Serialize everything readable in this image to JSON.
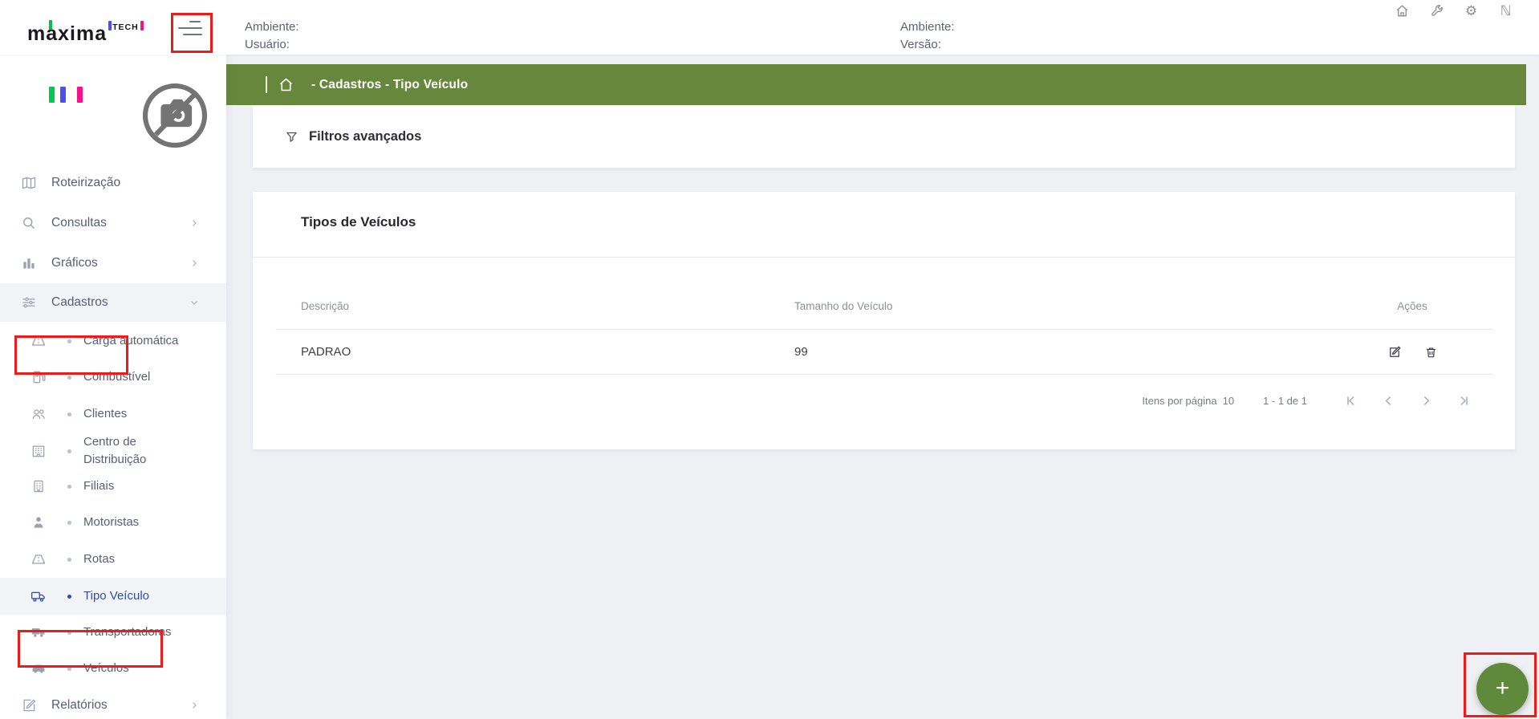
{
  "colors": {
    "breadcrumb_green": "#67873D",
    "fab_green": "#5F8A3C",
    "annotation_red": "#EE1B1B",
    "active_blue": "#2C4CAE",
    "edit_blue": "#3F58C9",
    "delete_red": "#E2403A",
    "logo_tick_green": "#00BF4F",
    "logo_tick_blue": "#4B50F0",
    "logo_tick_pink": "#F5128C"
  },
  "header": {
    "logo_text": "maxima",
    "logo_sub": "TECH",
    "env_label_left": "Ambiente:",
    "user_label": "Usuário:",
    "env_label_right": "Ambiente:",
    "version_label": "Versão:",
    "gear_glyph": "⚙",
    "n_glyph": "ℕ"
  },
  "breadcrumb": {
    "path": "- Cadastros - Tipo Veículo"
  },
  "filters": {
    "title": "Filtros avançados"
  },
  "vehicle_types": {
    "title": "Tipos de Veículos",
    "columns": {
      "descricao": "Descrição",
      "tamanho": "Tamanho do Veículo",
      "acoes": "Ações"
    },
    "rows": [
      {
        "descricao": "PADRAO",
        "tamanho": "99"
      }
    ],
    "pagination": {
      "items_per_page_label": "Itens por página",
      "items_per_page_value": "10",
      "range_label": "1 - 1 de 1"
    }
  },
  "sidebar": {
    "items": [
      {
        "label": "Roteirização",
        "icon": "map-icon"
      },
      {
        "label": "Consultas",
        "icon": "search-icon",
        "chevron": "right"
      },
      {
        "label": "Gráficos",
        "icon": "bar-chart-icon",
        "chevron": "right"
      },
      {
        "label": "Cadastros",
        "icon": "sliders-icon",
        "chevron": "down",
        "expanded": true,
        "annotated": true
      },
      {
        "label": "Carga automática",
        "icon": "road-icon"
      },
      {
        "label": "Combustível",
        "icon": "fuel-pump-icon"
      },
      {
        "label": "Clientes",
        "icon": "users-icon"
      },
      {
        "label": "Centro de Distribuição",
        "icon": "building-icon"
      },
      {
        "label": "Filiais",
        "icon": "branch-building-icon"
      },
      {
        "label": "Motoristas",
        "icon": "driver-icon"
      },
      {
        "label": "Rotas",
        "icon": "road-icon"
      },
      {
        "label": "Tipo Veículo",
        "icon": "truck-outline-icon",
        "active": true,
        "annotated": true
      },
      {
        "label": "Transportadoras",
        "icon": "truck-icon"
      },
      {
        "label": "Veículos",
        "icon": "car-icon"
      },
      {
        "label": "Relatórios",
        "icon": "report-icon",
        "chevron": "right"
      }
    ]
  },
  "fab": {
    "plus": "+"
  }
}
